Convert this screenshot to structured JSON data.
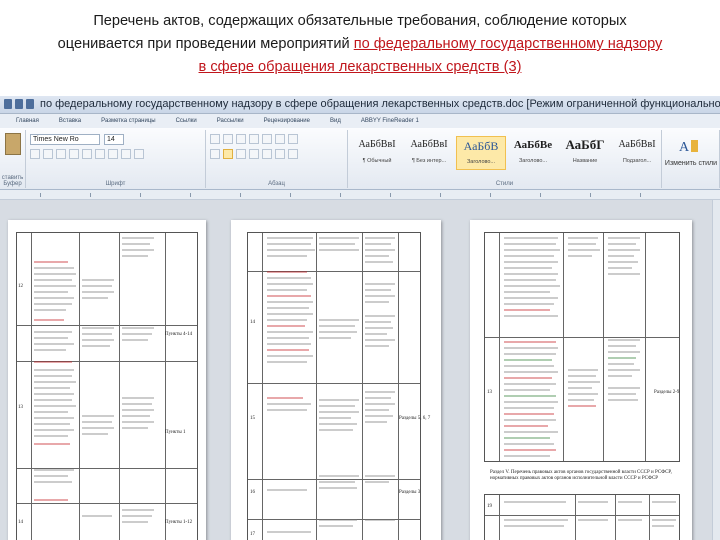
{
  "heading": {
    "line1": "Перечень актов, содержащих обязательные требования, соблюдение которых",
    "line2_plain": "оценивается при проведении мероприятий ",
    "line2_highlight": "по федеральному государственному надзору",
    "line3_highlight": "в сфере обращения лекарственных средств (3)"
  },
  "window": {
    "title": "по федеральному государственному надзору в сфере обращения лекарственных средств.doc [Режим ограниченной функциональности] - Mi..."
  },
  "menu": [
    "Главная",
    "Вставка",
    "Разметка страницы",
    "Ссылки",
    "Рассылки",
    "Рецензирование",
    "Вид",
    "ABBYY FineReader 1"
  ],
  "ribbon": {
    "font_name": "Times New Ro",
    "font_size": "14",
    "groups": {
      "clipboard": "ставить Буфер",
      "font": "Шрифт",
      "paragraph": "Абзац",
      "styles": "Стили",
      "change": "Изменить стили"
    },
    "styles": [
      {
        "sample": "АаБбВвІ",
        "name": "¶ Обычный"
      },
      {
        "sample": "АаБбВвІ",
        "name": "¶ Без интер..."
      },
      {
        "sample": "АаБбВ",
        "name": "Заголово..."
      },
      {
        "sample": "АаБбВе",
        "name": "Заголово..."
      },
      {
        "sample": "АаБбГ",
        "name": "Название"
      },
      {
        "sample": "АаБбВвІ",
        "name": "Подзагол..."
      }
    ]
  },
  "pages": {
    "p1": {
      "row_numbers": [
        "12",
        "13",
        "14"
      ],
      "refs": [
        "Пункты 4-14",
        "Пункты 1",
        "Пункты 1-12"
      ]
    },
    "p2": {
      "row_numbers": [
        "14",
        "15",
        "16",
        "17"
      ],
      "refs": [
        "Разделы 5, 6, 7",
        "Разделы 3"
      ]
    },
    "p3": {
      "row_numbers": [
        "13",
        "19"
      ],
      "refs": [
        "Разделы 2-9"
      ],
      "table_caption": "Раздел V. Перечень правовых актов органов государственной власти СССР и РСФСР, нормативных правовых актов органов исполнительной власти СССР и РСФСР"
    }
  }
}
